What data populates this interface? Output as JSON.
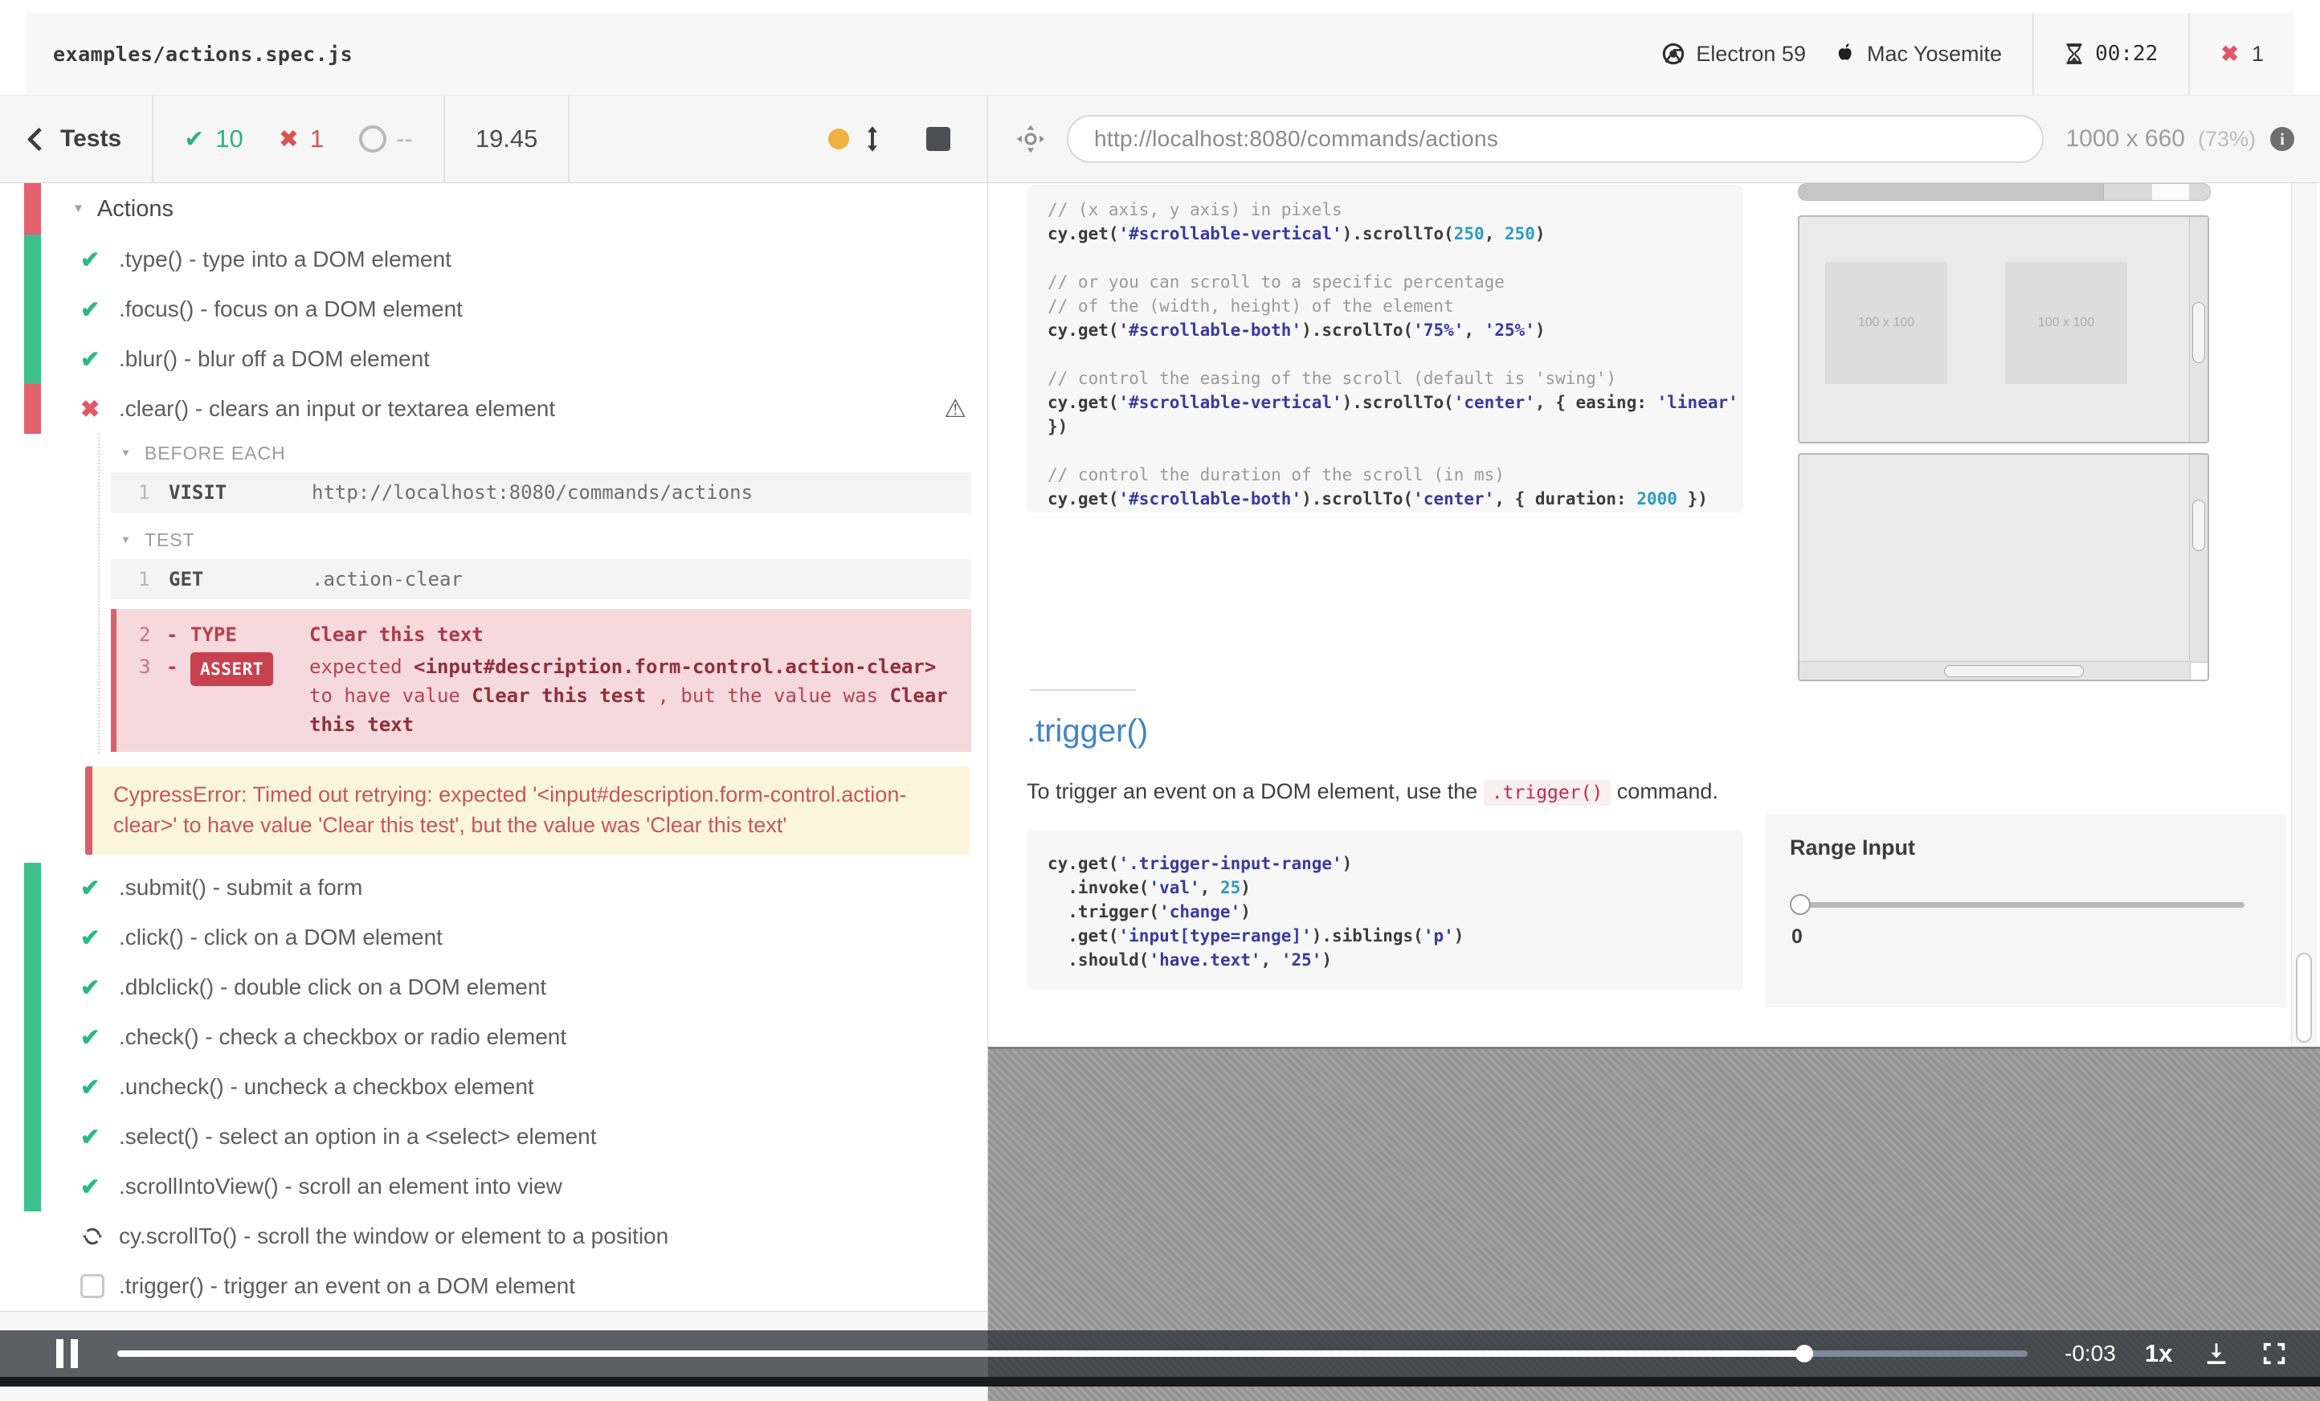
{
  "topbar": {
    "spec": "examples/actions.spec.js",
    "browser": "Electron 59",
    "os": "Mac Yosemite",
    "timer": "00:22",
    "failures": "1"
  },
  "toolbar": {
    "back_label": "Tests",
    "passed": "10",
    "failed": "1",
    "pending": "--",
    "duration": "19.45"
  },
  "urlbar": {
    "url": "http://localhost:8080/commands/actions",
    "viewport": "1000 x 660",
    "scale": "(73%)"
  },
  "reporter": {
    "suite_title": "Actions",
    "tests_a": [
      {
        "state": "passed",
        "label": ".type() - type into a DOM element"
      },
      {
        "state": "passed",
        "label": ".focus() - focus on a DOM element"
      },
      {
        "state": "passed",
        "label": ".blur() - blur off a DOM element"
      },
      {
        "state": "failed",
        "label": ".clear() - clears an input or textarea element",
        "warn": true
      }
    ],
    "detail": {
      "before_title": "BEFORE EACH",
      "test_title": "TEST",
      "visit": {
        "n": "1",
        "cmd": "VISIT",
        "msg": "http://localhost:8080/commands/actions"
      },
      "get": {
        "n": "1",
        "cmd": "GET",
        "msg": ".action-clear"
      },
      "type_row": {
        "n": "2",
        "dash": "-",
        "name": "TYPE",
        "msg": "Clear this text"
      },
      "assert_row": {
        "n": "3",
        "dash": "-",
        "badge": "ASSERT",
        "seg_pre": "expected ",
        "seg_selector": "<input#description.form-control.action-clear>",
        "seg_mid": " to have value ",
        "seg_expected": "Clear this test",
        "seg_mid2": " , but the value was ",
        "seg_actual": "Clear this text"
      }
    },
    "error_text": "CypressError: Timed out retrying: expected '<input#description.form-control.action-clear>' to have value 'Clear this test', but the value was 'Clear this text'",
    "tests_b": [
      {
        "state": "passed",
        "label": ".submit() - submit a form"
      },
      {
        "state": "passed",
        "label": ".click() - click on a DOM element"
      },
      {
        "state": "passed",
        "label": ".dblclick() - double click on a DOM element"
      },
      {
        "state": "passed",
        "label": ".check() - check a checkbox or radio element"
      },
      {
        "state": "passed",
        "label": ".uncheck() - uncheck a checkbox element"
      },
      {
        "state": "passed",
        "label": ".select() - select an option in a <select> element"
      },
      {
        "state": "passed",
        "label": ".scrollIntoView() - scroll an element into view"
      },
      {
        "state": "running",
        "label": "cy.scrollTo() - scroll the window or element to a position"
      },
      {
        "state": "pending",
        "label": ".trigger() - trigger an event on a DOM element"
      }
    ]
  },
  "app": {
    "code1": {
      "lines": [
        [
          {
            "t": "// (x axis, y axis) in pixels",
            "c": "cm"
          }
        ],
        [
          {
            "t": "cy.get(",
            "c": "pln"
          },
          {
            "t": "'#scrollable-vertical'",
            "c": "str"
          },
          {
            "t": ").scrollTo(",
            "c": "pln"
          },
          {
            "t": "250",
            "c": "num"
          },
          {
            "t": ", ",
            "c": "pln"
          },
          {
            "t": "250",
            "c": "num"
          },
          {
            "t": ")",
            "c": "pln"
          }
        ],
        [],
        [
          {
            "t": "// or you can scroll to a specific percentage",
            "c": "cm"
          }
        ],
        [
          {
            "t": "// of the (width, height) of the element",
            "c": "cm"
          }
        ],
        [
          {
            "t": "cy.get(",
            "c": "pln"
          },
          {
            "t": "'#scrollable-both'",
            "c": "str"
          },
          {
            "t": ").scrollTo(",
            "c": "pln"
          },
          {
            "t": "'75%'",
            "c": "str"
          },
          {
            "t": ", ",
            "c": "pln"
          },
          {
            "t": "'25%'",
            "c": "str"
          },
          {
            "t": ")",
            "c": "pln"
          }
        ],
        [],
        [
          {
            "t": "// control the easing of the scroll (default is 'swing')",
            "c": "cm"
          }
        ],
        [
          {
            "t": "cy.get(",
            "c": "pln"
          },
          {
            "t": "'#scrollable-vertical'",
            "c": "str"
          },
          {
            "t": ").scrollTo(",
            "c": "pln"
          },
          {
            "t": "'center'",
            "c": "str"
          },
          {
            "t": ", { easing: ",
            "c": "pln"
          },
          {
            "t": "'linear'",
            "c": "str"
          }
        ],
        [
          {
            "t": "})",
            "c": "pln"
          }
        ],
        [],
        [
          {
            "t": "// control the duration of the scroll (in ms)",
            "c": "cm"
          }
        ],
        [
          {
            "t": "cy.get(",
            "c": "pln"
          },
          {
            "t": "'#scrollable-both'",
            "c": "str"
          },
          {
            "t": ").scrollTo(",
            "c": "pln"
          },
          {
            "t": "'center'",
            "c": "str"
          },
          {
            "t": ", { duration: ",
            "c": "pln"
          },
          {
            "t": "2000",
            "c": "num"
          },
          {
            "t": " })",
            "c": "pln"
          }
        ]
      ]
    },
    "trigger": {
      "heading": ".trigger()",
      "p1": "To trigger an event on a DOM element, use the ",
      "code": ".trigger()",
      "p2": " command."
    },
    "code2": {
      "lines": [
        [
          {
            "t": "cy.get(",
            "c": "pln"
          },
          {
            "t": "'.trigger-input-range'",
            "c": "str"
          },
          {
            "t": ")",
            "c": "pln"
          }
        ],
        [
          {
            "t": "  .invoke(",
            "c": "pln"
          },
          {
            "t": "'val'",
            "c": "str"
          },
          {
            "t": ", ",
            "c": "pln"
          },
          {
            "t": "25",
            "c": "num"
          },
          {
            "t": ")",
            "c": "pln"
          }
        ],
        [
          {
            "t": "  .trigger(",
            "c": "pln"
          },
          {
            "t": "'change'",
            "c": "str"
          },
          {
            "t": ")",
            "c": "pln"
          }
        ],
        [
          {
            "t": "  .get(",
            "c": "pln"
          },
          {
            "t": "'input[type=range]'",
            "c": "str"
          },
          {
            "t": ").siblings(",
            "c": "pln"
          },
          {
            "t": "'p'",
            "c": "str"
          },
          {
            "t": ")",
            "c": "pln"
          }
        ],
        [
          {
            "t": "  .should(",
            "c": "pln"
          },
          {
            "t": "'have.text'",
            "c": "str"
          },
          {
            "t": ", ",
            "c": "pln"
          },
          {
            "t": "'25'",
            "c": "str"
          },
          {
            "t": ")",
            "c": "pln"
          }
        ]
      ]
    },
    "demo": {
      "sq1": "100 x 100",
      "sq2": "100 x 100"
    },
    "range": {
      "label": "Range Input",
      "value": "0"
    }
  },
  "player": {
    "time": "-0:03",
    "rate": "1x",
    "progress_pct": 88.3
  }
}
